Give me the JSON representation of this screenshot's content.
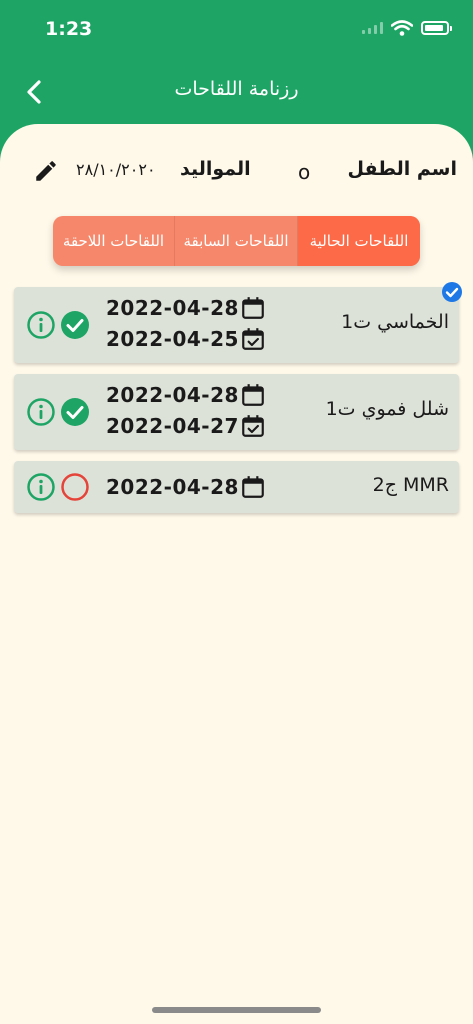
{
  "status_bar": {
    "time": "1:23"
  },
  "app_bar": {
    "title": "رزنامة اللقاحات"
  },
  "child": {
    "name_label": "اسم الطفل",
    "name_value": "o",
    "birth_label": "المواليد",
    "birth_value": "٢٨/١٠/٢٠٢٠"
  },
  "tabs": [
    {
      "label": "اللقاحات الحالية",
      "selected": true
    },
    {
      "label": "اللقاحات السابقة",
      "selected": false
    },
    {
      "label": "اللقاحات اللاحقة",
      "selected": false
    }
  ],
  "vaccines": [
    {
      "name": "الخماسي ت1",
      "due_date": "2022-04-28",
      "given_date": "2022-04-25",
      "status": "given"
    },
    {
      "name": "شلل فموي ت1",
      "due_date": "2022-04-28",
      "given_date": "2022-04-27",
      "status": "given"
    },
    {
      "name": "MMR ج2",
      "due_date": "2022-04-28",
      "status": "pending"
    }
  ],
  "colors": {
    "primary_green": "#1ea565",
    "background_cream": "#fff9ea",
    "tab_orange": "#f6876a",
    "tab_selected": "#fc6a48",
    "card_gray": "#dde2d9",
    "pending_red": "#e5443a",
    "badge_blue": "#1e78e6"
  }
}
